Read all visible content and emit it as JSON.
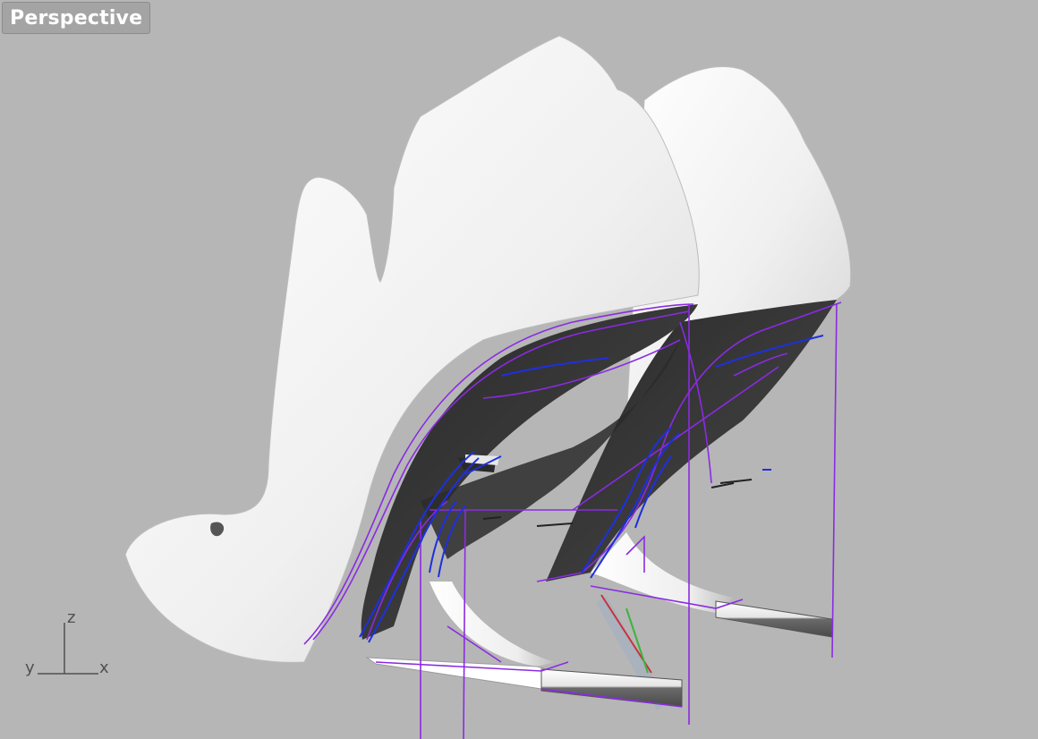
{
  "viewport": {
    "title": "Perspective"
  },
  "axes": {
    "z": "z",
    "y": "y",
    "x": "x"
  },
  "colors": {
    "background": "#b6b6b6",
    "model": "#f2f2f2",
    "model_shadow": "#1a1a1a",
    "curve_purple": "#8a2be2",
    "curve_blue": "#1f2fe0",
    "axis_red": "#c8323c",
    "axis_green": "#3cb43c"
  }
}
